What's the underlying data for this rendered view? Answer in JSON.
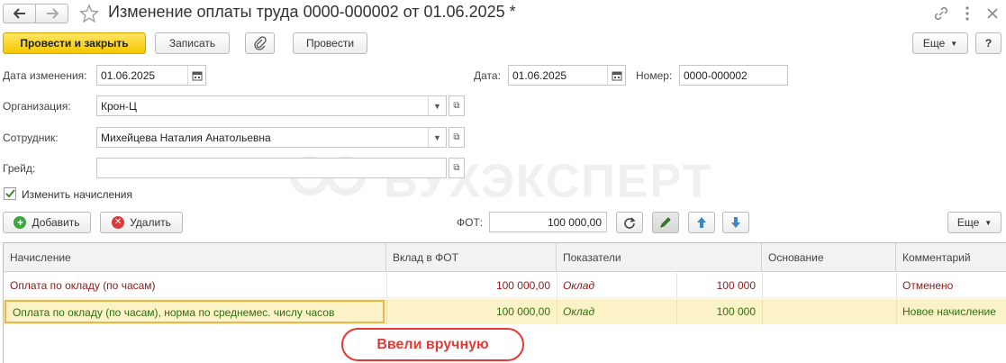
{
  "window": {
    "title": "Изменение оплаты труда 0000-000002 от 01.06.2025 *"
  },
  "toolbar": {
    "post_close_label": "Провести и закрыть",
    "save_label": "Записать",
    "post_label": "Провести",
    "more_label": "Еще",
    "help_label": "?"
  },
  "form": {
    "change_date_label": "Дата изменения:",
    "change_date_value": "01.06.2025",
    "date_label": "Дата:",
    "date_value": "01.06.2025",
    "number_label": "Номер:",
    "number_value": "0000-000002",
    "org_label": "Организация:",
    "org_value": "Крон-Ц",
    "employee_label": "Сотрудник:",
    "employee_value": "Михейцева Наталия Анатольевна",
    "grade_label": "Грейд:",
    "grade_value": "",
    "change_accruals_label": "Изменить начисления",
    "change_accruals_checked": true
  },
  "table_toolbar": {
    "add_label": "Добавить",
    "delete_label": "Удалить",
    "fot_label": "ФОТ:",
    "fot_value": "100 000,00",
    "more_label": "Еще"
  },
  "table": {
    "columns": [
      "Начисление",
      "Вклад в ФОТ",
      "Показатели",
      "Основание",
      "Комментарий"
    ],
    "rows": [
      {
        "accrual": "Оплата по окладу (по часам)",
        "contribution": "100 000,00",
        "indicator": "Оклад",
        "indicator_value": "100 000",
        "basis": "",
        "comment": "Отменено"
      },
      {
        "accrual": "Оплата по окладу (по часам), норма по среднемес. числу часов",
        "contribution": "100 000,00",
        "indicator": "Оклад",
        "indicator_value": "100 000",
        "basis": "",
        "comment": "Новое начисление"
      }
    ]
  },
  "watermark": "БУХЭКСПЕРТ",
  "callout": "Ввели вручную",
  "colors": {
    "primary_button": "#f5c800",
    "cancelled_row_text": "#8b1a1a",
    "new_row_text": "#2e6e12",
    "selected_row_bg": "#fbf3c7",
    "callout": "#e53935"
  }
}
